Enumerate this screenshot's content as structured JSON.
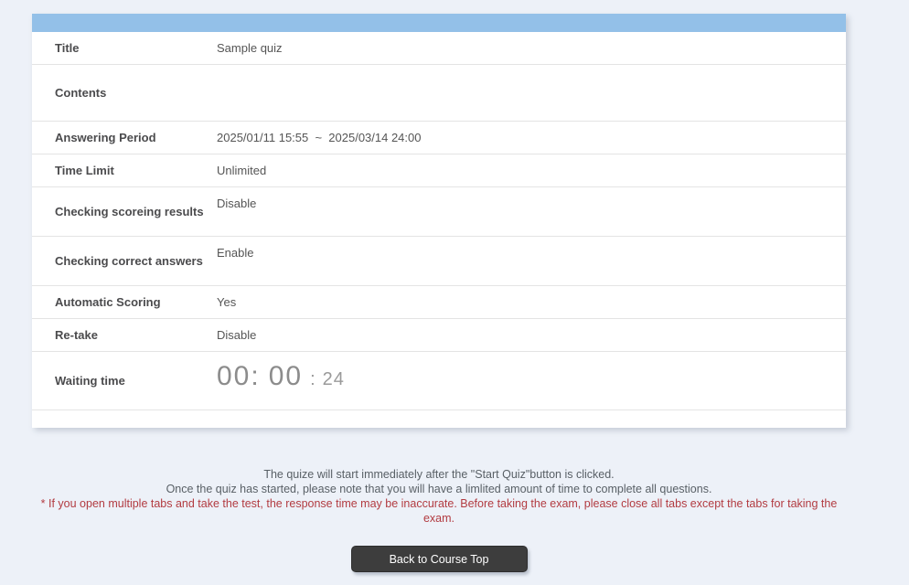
{
  "panel": {
    "header_color": "#93c0e8",
    "rows": [
      {
        "label": "Title",
        "value": "Sample quiz"
      },
      {
        "label": "Contents",
        "value": ""
      },
      {
        "label": "Answering Period",
        "value": "2025/01/11 15:55  ~  2025/03/14 24:00"
      },
      {
        "label": "Time Limit",
        "value": "Unlimited"
      },
      {
        "label": "Checking scoreing results",
        "value": "Disable"
      },
      {
        "label": "Checking correct answers",
        "value": "Enable"
      },
      {
        "label": "Automatic Scoring",
        "value": "Yes"
      },
      {
        "label": "Re-take",
        "value": "Disable"
      }
    ],
    "waiting_time": {
      "label": "Waiting time",
      "hours": "00",
      "minutes": "00",
      "seconds": "24",
      "separator": ":"
    }
  },
  "notes": {
    "line1": "The quize will start immediately after the \"Start Quiz\"button is clicked.",
    "line2": "Once the quiz has started, please note that you will have a limlited amount of time to complete all questions.",
    "warning": "* If you open multiple tabs and take the test, the response time may be inaccurate. Before taking the exam, please close all tabs except the tabs for taking the exam.",
    "warning_color": "#b23b41"
  },
  "footer": {
    "back_button_label": "Back to Course Top"
  }
}
